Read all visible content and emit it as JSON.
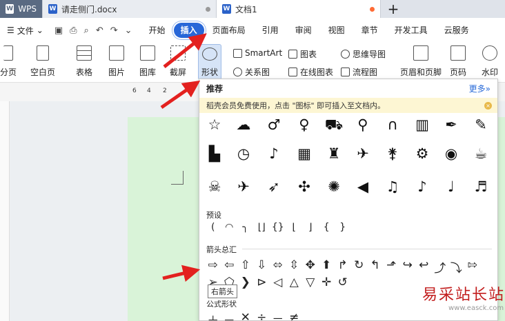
{
  "tabs": [
    {
      "label": "WPS",
      "icon": "wps-logo-icon"
    },
    {
      "label": "请走侧门.docx",
      "icon": "word-doc-icon"
    },
    {
      "label": "文档1",
      "icon": "word-doc-icon"
    }
  ],
  "new_tab": "+",
  "menubar": {
    "file": "文件",
    "items": [
      "开始",
      "插入",
      "页面布局",
      "引用",
      "审阅",
      "视图",
      "章节",
      "开发工具",
      "云服务"
    ],
    "active": "插入"
  },
  "ribbon": {
    "pagebreak": "分页",
    "blankpage": "空白页",
    "table": "表格",
    "picture": "图片",
    "gallery": "图库",
    "screenshot": "截屏",
    "shape": "形状",
    "smartart": "SmartArt",
    "chart": "图表",
    "mindmap": "思维导图",
    "relation": "关系图",
    "onlinechart": "在线图表",
    "flowchart": "流程图",
    "header_footer": "页眉和页脚",
    "page_number": "页码",
    "watermark": "水印"
  },
  "ruler": [
    "6",
    "4",
    "2"
  ],
  "panel": {
    "title": "推荐",
    "more": "更多»",
    "notice": "稻壳会员免费使用，点击 \"图标\" 即可插入至文档内。",
    "section_preset": "预设",
    "section_arrows": "箭头总汇",
    "section_formula": "公式形状",
    "tooltip": "右箭头"
  },
  "watermark_text": "易采站长站",
  "watermark_url": "www.easck.com",
  "colors": {
    "accent": "#2867d8",
    "arrow": "#e3211f",
    "page": "#d9f3d8"
  }
}
